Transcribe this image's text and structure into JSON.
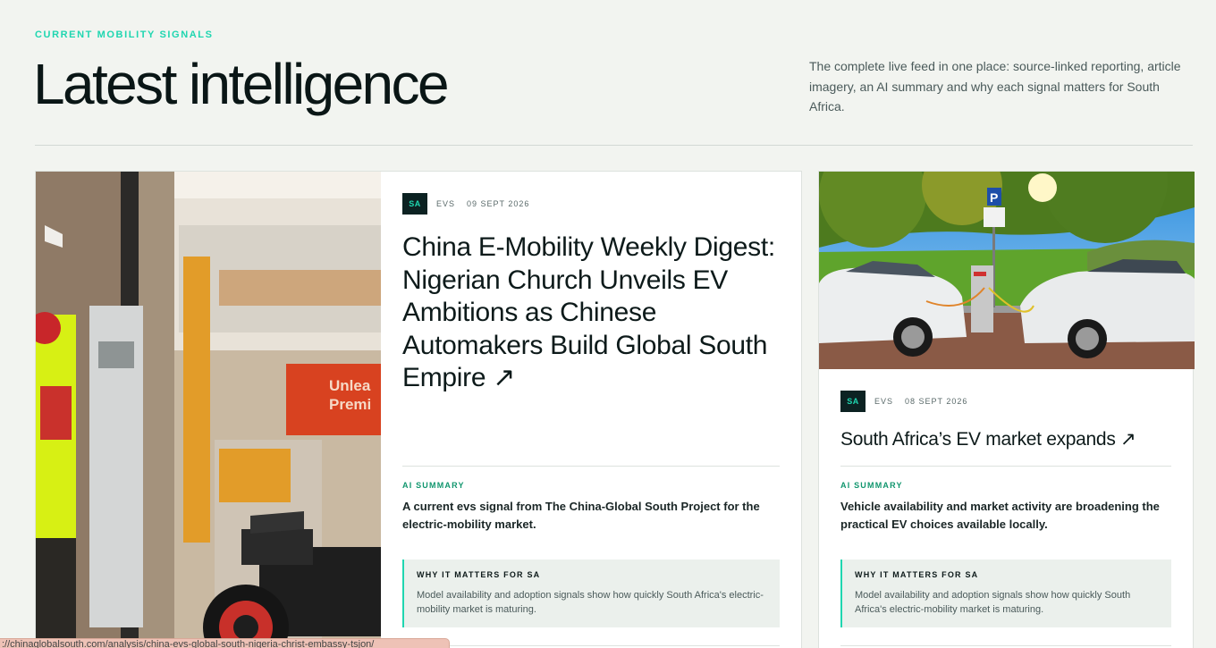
{
  "header": {
    "eyebrow": "CURRENT MOBILITY SIGNALS",
    "title": "Latest intelligence",
    "intro": "The complete live feed in one place: source-linked reporting, article imagery, an AI summary and why each signal matters for South Africa."
  },
  "featured": {
    "badge": "SA",
    "category": "EVS",
    "date": "09 SEPT 2026",
    "headline": "China E-Mobility Weekly Digest: Nigerian Church Unveils EV Ambitions as Chinese Automakers Build Global South Empire ↗",
    "ai_label": "AI SUMMARY",
    "ai_text": "A current evs signal from The China-Global South Project for the electric-mobility market.",
    "why_label": "WHY IT MATTERS FOR SA",
    "why_text": "Model availability and adoption signals show how quickly South Africa's electric-mobility market is maturing.",
    "image_text": "Unleaded Premium"
  },
  "side": {
    "badge": "SA",
    "category": "EVS",
    "date": "08 SEPT 2026",
    "headline": "South Africa’s EV market expands ↗",
    "ai_label": "AI SUMMARY",
    "ai_text": "Vehicle availability and market activity are broadening the practical EV choices available locally.",
    "why_label": "WHY IT MATTERS FOR SA",
    "why_text": "Model availability and adoption signals show how quickly South Africa's electric-mobility market is maturing.",
    "image_sign": "P"
  },
  "status_bar": {
    "url": "://chinaglobalsouth.com/analysis/china-evs-global-south-nigeria-christ-embassy-tsjon/"
  },
  "colors": {
    "accent": "#1fd6b0",
    "badge_bg": "#0c2222",
    "ai_label": "#11966e",
    "background": "#f2f4f0"
  }
}
